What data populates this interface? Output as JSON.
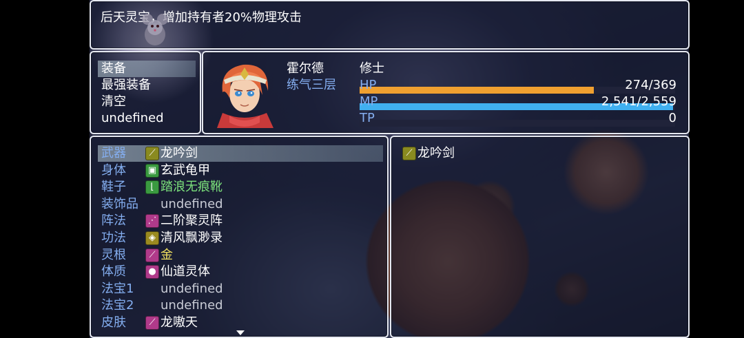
{
  "help": {
    "text": "后天灵宝，增加持有者20%物理攻击"
  },
  "command": {
    "items": [
      {
        "label": "装备"
      },
      {
        "label": "最强装备"
      },
      {
        "label": "清空"
      },
      {
        "label": "undefined"
      }
    ],
    "selected_index": 0
  },
  "actor": {
    "name": "霍尔德",
    "level_label": "练气三层",
    "class": "修士",
    "hp": {
      "label": "HP",
      "value": "274/369",
      "fraction": 0.743,
      "color": "#f0a030"
    },
    "mp": {
      "label": "MP",
      "value": "2,541/2,559",
      "fraction": 0.993,
      "color": "#40b0f0"
    },
    "tp": {
      "label": "TP",
      "value": "0",
      "fraction": 0,
      "color": "#30c060"
    }
  },
  "slots": [
    {
      "name": "武器",
      "item": "龙吟剑",
      "icon": "sword-icon",
      "icon_color": "#8a8a20"
    },
    {
      "name": "身体",
      "item": "玄武龟甲",
      "icon": "armor-icon",
      "icon_color": "#3a9a40"
    },
    {
      "name": "鞋子",
      "item": "踏浪无痕靴",
      "icon": "boots-icon",
      "icon_color": "#3a9a40",
      "item_color": "#7ce27c"
    },
    {
      "name": "装饰品",
      "item": "undefined",
      "icon": null
    },
    {
      "name": "阵法",
      "item": "二阶聚灵阵",
      "icon": "formation-icon",
      "icon_color": "#b03a8a"
    },
    {
      "name": "功法",
      "item": "清风飘渺录",
      "icon": "scroll-icon",
      "icon_color": "#9a8a20"
    },
    {
      "name": "灵根",
      "item": "金",
      "icon": "root-icon",
      "icon_color": "#b03a8a",
      "item_color": "#f0e060"
    },
    {
      "name": "体质",
      "item": "仙道灵体",
      "icon": "orb-icon",
      "icon_color": "#b03a8a"
    },
    {
      "name": "法宝1",
      "item": "undefined",
      "icon": null
    },
    {
      "name": "法宝2",
      "item": "undefined",
      "icon": null
    },
    {
      "name": "皮肤",
      "item": "龙嗷天",
      "icon": "feather-icon",
      "icon_color": "#b03a8a"
    }
  ],
  "selected_slot": 0,
  "item_list": [
    {
      "item": "龙吟剑",
      "icon": "sword-icon",
      "icon_color": "#8a8a20"
    }
  ]
}
